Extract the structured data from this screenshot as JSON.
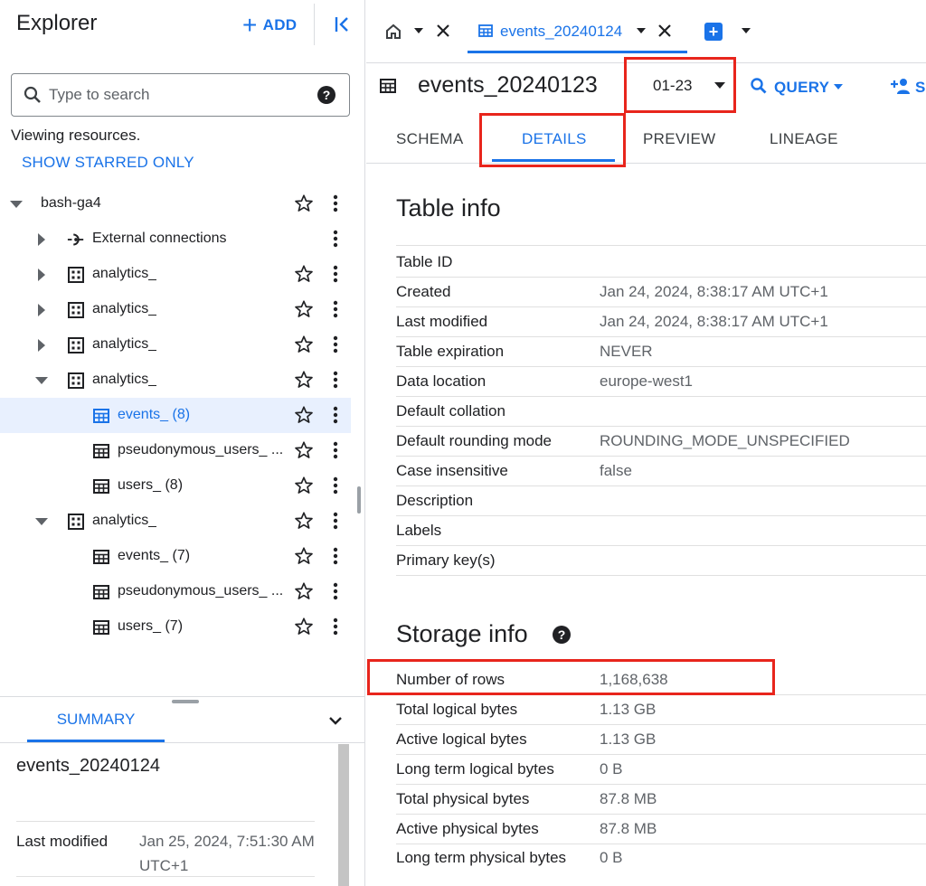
{
  "explorer": {
    "title": "Explorer",
    "add_label": "ADD",
    "search_placeholder": "Type to search",
    "viewing_text": "Viewing resources.",
    "starred_label": "SHOW STARRED ONLY",
    "tree": [
      {
        "label": "bash-ga4",
        "icon": "project",
        "expanded": true
      },
      {
        "label": "External connections",
        "icon": "connection",
        "expanded": false
      },
      {
        "label": "analytics_",
        "icon": "dataset",
        "expanded": false
      },
      {
        "label": "analytics_",
        "icon": "dataset",
        "expanded": false
      },
      {
        "label": "analytics_",
        "icon": "dataset",
        "expanded": false
      },
      {
        "label": "analytics_",
        "icon": "dataset",
        "expanded": true
      },
      {
        "label": "events_ (8)",
        "icon": "table",
        "selected": true
      },
      {
        "label": "pseudonymous_users_ ...",
        "icon": "table"
      },
      {
        "label": "users_ (8)",
        "icon": "table"
      },
      {
        "label": "analytics_",
        "icon": "dataset",
        "expanded": true
      },
      {
        "label": "events_ (7)",
        "icon": "table"
      },
      {
        "label": "pseudonymous_users_ ...",
        "icon": "table"
      },
      {
        "label": "users_ (7)",
        "icon": "table"
      }
    ]
  },
  "summary": {
    "tab_label": "SUMMARY",
    "name": "events_20240124",
    "last_modified_key": "Last modified",
    "last_modified_val": "Jan 25, 2024, 7:51:30 AM UTC+1"
  },
  "tabs": {
    "active_label": "events_20240124"
  },
  "header": {
    "title": "events_20240123",
    "snapshot": "01-23",
    "query_label": "QUERY",
    "share_label": "S"
  },
  "subtabs": [
    "SCHEMA",
    "DETAILS",
    "PREVIEW",
    "LINEAGE"
  ],
  "table_info": {
    "title": "Table info",
    "rows": [
      {
        "key": "Table ID",
        "value": ""
      },
      {
        "key": "Created",
        "value": "Jan 24, 2024, 8:38:17 AM UTC+1"
      },
      {
        "key": "Last modified",
        "value": "Jan 24, 2024, 8:38:17 AM UTC+1"
      },
      {
        "key": "Table expiration",
        "value": "NEVER"
      },
      {
        "key": "Data location",
        "value": "europe-west1"
      },
      {
        "key": "Default collation",
        "value": ""
      },
      {
        "key": "Default rounding mode",
        "value": "ROUNDING_MODE_UNSPECIFIED"
      },
      {
        "key": "Case insensitive",
        "value": "false"
      },
      {
        "key": "Description",
        "value": ""
      },
      {
        "key": "Labels",
        "value": ""
      },
      {
        "key": "Primary key(s)",
        "value": ""
      }
    ]
  },
  "storage_info": {
    "title": "Storage info",
    "rows": [
      {
        "key": "Number of rows",
        "value": "1,168,638"
      },
      {
        "key": "Total logical bytes",
        "value": "1.13 GB"
      },
      {
        "key": "Active logical bytes",
        "value": "1.13 GB"
      },
      {
        "key": "Long term logical bytes",
        "value": "0 B"
      },
      {
        "key": "Total physical bytes",
        "value": "87.8 MB"
      },
      {
        "key": "Active physical bytes",
        "value": "87.8 MB"
      },
      {
        "key": "Long term physical bytes",
        "value": "0 B"
      }
    ]
  },
  "colors": {
    "accent": "#1a73e8",
    "highlight": "#e8251c",
    "selected_bg": "#e8f0fe"
  }
}
